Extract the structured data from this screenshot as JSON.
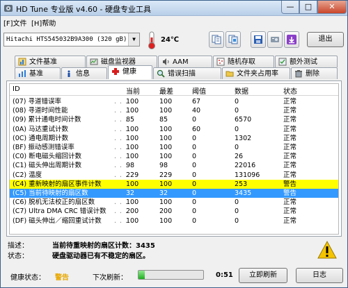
{
  "window": {
    "title": "HD Tune 专业版 v4.60 - 硬盘专业工具",
    "minimize_glyph": "—",
    "maximize_glyph": "□",
    "close_glyph": "✕"
  },
  "menu": {
    "file": "[F]文件",
    "help": "[H]帮助"
  },
  "toolbar": {
    "drive_label": "Hitachi HTS545032B9A300 (320 gB)",
    "temperature": "24℃",
    "exit_label": "退出",
    "icons": [
      "copy-text-icon",
      "copy-screenshot-icon",
      "save-icon",
      "disk-options-icon",
      "download-icon"
    ]
  },
  "tabs": {
    "row1": [
      "文件基准",
      "磁盘监视器",
      "AAM",
      "随机存取",
      "额外测试"
    ],
    "row2": [
      "基准",
      "信息",
      "健康",
      "错误扫描",
      "文件夹占用率",
      "删除"
    ],
    "active": "健康"
  },
  "table": {
    "headers": [
      "ID",
      "当前",
      "最差",
      "阈值",
      "数据",
      "状态"
    ],
    "rows": [
      {
        "id": "(07) 寻道错误率",
        "current": "100",
        "worst": "100",
        "threshold": "67",
        "data": "0",
        "status": "正常"
      },
      {
        "id": "(08) 寻道时间性能",
        "current": "100",
        "worst": "100",
        "threshold": "40",
        "data": "0",
        "status": "正常"
      },
      {
        "id": "(09) 累计通电时间计数",
        "current": "85",
        "worst": "85",
        "threshold": "0",
        "data": "6570",
        "status": "正常"
      },
      {
        "id": "(0A) 马达重试计数",
        "current": "100",
        "worst": "100",
        "threshold": "60",
        "data": "0",
        "status": "正常"
      },
      {
        "id": "(0C) 通电周期计数",
        "current": "100",
        "worst": "100",
        "threshold": "0",
        "data": "1302",
        "status": "正常"
      },
      {
        "id": "(BF) 振动感测错误率",
        "current": "100",
        "worst": "100",
        "threshold": "0",
        "data": "0",
        "status": "正常"
      },
      {
        "id": "(C0) 断电磁头缩回计数",
        "current": "100",
        "worst": "100",
        "threshold": "0",
        "data": "26",
        "status": "正常"
      },
      {
        "id": "(C1) 磁头伸出周期计数",
        "current": "98",
        "worst": "98",
        "threshold": "0",
        "data": "22016",
        "status": "正常"
      },
      {
        "id": "(C2) 温度",
        "current": "229",
        "worst": "229",
        "threshold": "0",
        "data": "131096",
        "status": "正常"
      },
      {
        "id": "(C4) 重新映射的扇区事件计数",
        "current": "100",
        "worst": "100",
        "threshold": "0",
        "data": "253",
        "status": "警告",
        "highlight": "yellow"
      },
      {
        "id": "(C5) 当前待映射的扇区数",
        "current": "32",
        "worst": "32",
        "threshold": "0",
        "data": "3435",
        "status": "警告",
        "highlight": "blue"
      },
      {
        "id": "(C6) 脱机无法校正的扇区数",
        "current": "100",
        "worst": "100",
        "threshold": "0",
        "data": "0",
        "status": "正常"
      },
      {
        "id": "(C7) Ultra DMA CRC 错误计数",
        "current": "200",
        "worst": "200",
        "threshold": "0",
        "data": "0",
        "status": "正常"
      },
      {
        "id": "(DF) 磁头伸出／缩回重试计数",
        "current": "100",
        "worst": "100",
        "threshold": "0",
        "data": "0",
        "status": "正常"
      }
    ]
  },
  "details": {
    "desc_label": "描述：",
    "desc_value": "当前待重映射的扇区计数：3435",
    "status_label": "状态：",
    "status_value": "硬盘驱动器已有不稳定的扇区。"
  },
  "statusbar": {
    "health_label": "健康状态：",
    "health_value": "警告",
    "next_refresh_label": "下次刷新：",
    "countdown": "0:51",
    "refresh_progress": 0.1,
    "refresh_label": "立即刷新",
    "log_label": "日志"
  },
  "colors": {
    "warning_text": "#e8a800",
    "row_yellow": "#ffff00",
    "row_blue": "#3399ff"
  }
}
